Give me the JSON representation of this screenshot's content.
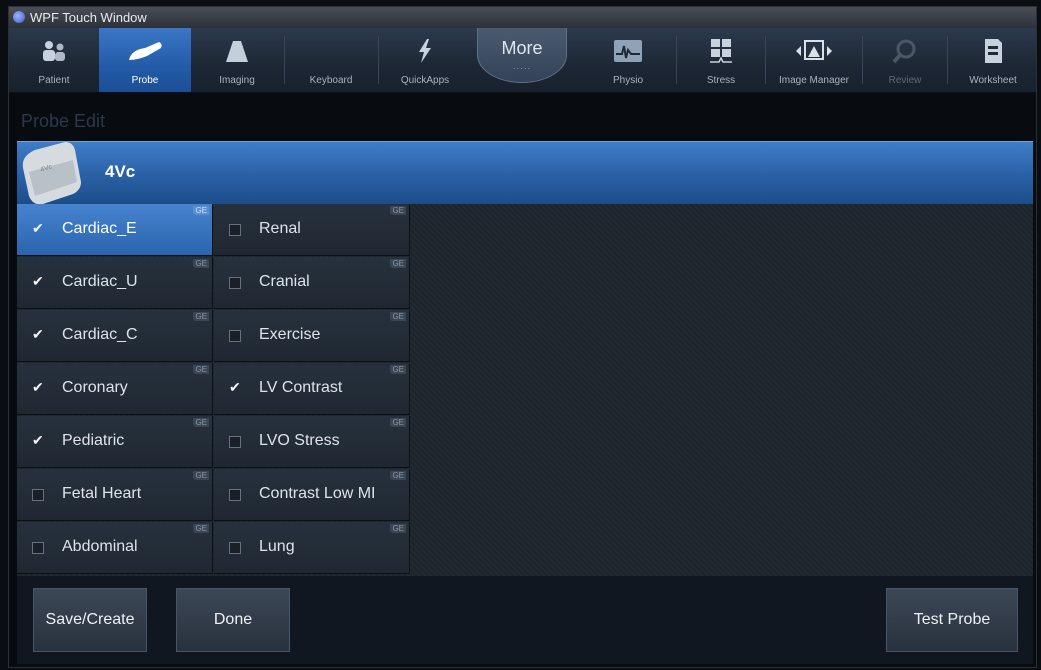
{
  "window": {
    "title": "WPF Touch Window"
  },
  "toolbar": {
    "items": [
      {
        "label": "Patient",
        "icon": "patient-icon",
        "active": false,
        "disabled": false
      },
      {
        "label": "Probe",
        "icon": "probe-icon",
        "active": true,
        "disabled": false
      },
      {
        "label": "Imaging",
        "icon": "imaging-icon",
        "active": false,
        "disabled": false
      },
      {
        "label": "Keyboard",
        "icon": "keyboard-icon",
        "active": false,
        "disabled": false
      },
      {
        "label": "QuickApps",
        "icon": "lightning-icon",
        "active": false,
        "disabled": false
      },
      {
        "label": "Physio",
        "icon": "ecg-icon",
        "active": false,
        "disabled": false
      },
      {
        "label": "Stress",
        "icon": "stress-grid-icon",
        "active": false,
        "disabled": false
      },
      {
        "label": "Image Manager",
        "icon": "image-manager-icon",
        "active": false,
        "disabled": false
      },
      {
        "label": "Review",
        "icon": "magnifier-icon",
        "active": false,
        "disabled": true
      },
      {
        "label": "Worksheet",
        "icon": "worksheet-icon",
        "active": false,
        "disabled": false
      }
    ],
    "more": {
      "label": "More",
      "dots": "·····"
    }
  },
  "page": {
    "title": "Probe Edit"
  },
  "probe": {
    "name": "4Vc",
    "icon": "probe-head-icon",
    "image_text": "4Vc"
  },
  "presets": {
    "badge": "GE",
    "left": [
      {
        "label": "Cardiac_E",
        "checked": true,
        "selected": true
      },
      {
        "label": "Cardiac_U",
        "checked": true,
        "selected": false
      },
      {
        "label": "Cardiac_C",
        "checked": true,
        "selected": false
      },
      {
        "label": "Coronary",
        "checked": true,
        "selected": false
      },
      {
        "label": "Pediatric",
        "checked": true,
        "selected": false
      },
      {
        "label": "Fetal Heart",
        "checked": false,
        "selected": false
      },
      {
        "label": "Abdominal",
        "checked": false,
        "selected": false
      }
    ],
    "right": [
      {
        "label": "Renal",
        "checked": false,
        "selected": false
      },
      {
        "label": "Cranial",
        "checked": false,
        "selected": false
      },
      {
        "label": "Exercise",
        "checked": false,
        "selected": false
      },
      {
        "label": "LV Contrast",
        "checked": true,
        "selected": false
      },
      {
        "label": "LVO Stress",
        "checked": false,
        "selected": false
      },
      {
        "label": "Contrast Low MI",
        "checked": false,
        "selected": false
      },
      {
        "label": "Lung",
        "checked": false,
        "selected": false
      }
    ]
  },
  "actions": {
    "save_create": "Save/Create",
    "done": "Done",
    "test_probe": "Test Probe"
  },
  "colors": {
    "accent": "#2b64ad",
    "toolbar_bg": "#1d2735",
    "panel_bg": "#1c242c"
  }
}
